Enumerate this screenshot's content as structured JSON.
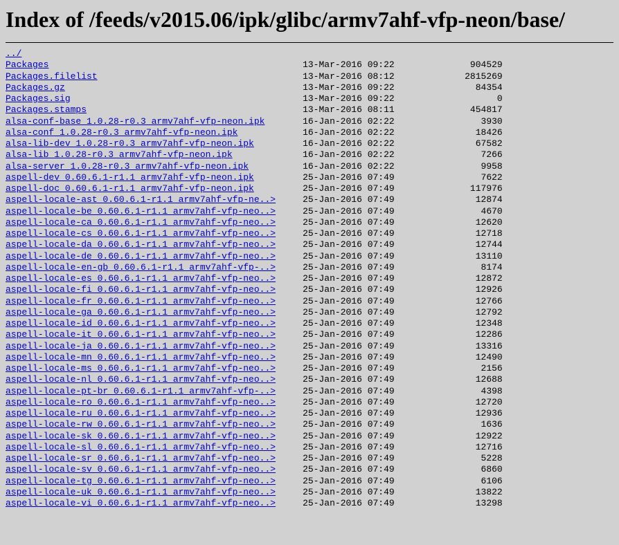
{
  "title": "Index of /feeds/v2015.06/ipk/glibc/armv7ahf-vfp-neon/base/",
  "parent": "../",
  "name_col_width": 55,
  "date_col_width": 17,
  "size_col_width": 19,
  "files": [
    {
      "name": "Packages",
      "date": "13-Mar-2016 09:22",
      "size": "904529"
    },
    {
      "name": "Packages.filelist",
      "date": "13-Mar-2016 08:12",
      "size": "2815269"
    },
    {
      "name": "Packages.gz",
      "date": "13-Mar-2016 09:22",
      "size": "84354"
    },
    {
      "name": "Packages.sig",
      "date": "13-Mar-2016 09:22",
      "size": "0"
    },
    {
      "name": "Packages.stamps",
      "date": "13-Mar-2016 08:11",
      "size": "454817"
    },
    {
      "name": "alsa-conf-base_1.0.28-r0.3_armv7ahf-vfp-neon.ipk",
      "date": "16-Jan-2016 02:22",
      "size": "3930"
    },
    {
      "name": "alsa-conf_1.0.28-r0.3_armv7ahf-vfp-neon.ipk",
      "date": "16-Jan-2016 02:22",
      "size": "18426"
    },
    {
      "name": "alsa-lib-dev_1.0.28-r0.3_armv7ahf-vfp-neon.ipk",
      "date": "16-Jan-2016 02:22",
      "size": "67582"
    },
    {
      "name": "alsa-lib_1.0.28-r0.3_armv7ahf-vfp-neon.ipk",
      "date": "16-Jan-2016 02:22",
      "size": "7266"
    },
    {
      "name": "alsa-server_1.0.28-r0.3_armv7ahf-vfp-neon.ipk",
      "date": "16-Jan-2016 02:22",
      "size": "9958"
    },
    {
      "name": "aspell-dev_0.60.6.1-r1.1_armv7ahf-vfp-neon.ipk",
      "date": "25-Jan-2016 07:49",
      "size": "7622"
    },
    {
      "name": "aspell-doc_0.60.6.1-r1.1_armv7ahf-vfp-neon.ipk",
      "date": "25-Jan-2016 07:49",
      "size": "117976"
    },
    {
      "name": "aspell-locale-ast_0.60.6.1-r1.1_armv7ahf-vfp-ne..>",
      "date": "25-Jan-2016 07:49",
      "size": "12874"
    },
    {
      "name": "aspell-locale-be_0.60.6.1-r1.1_armv7ahf-vfp-neo..>",
      "date": "25-Jan-2016 07:49",
      "size": "4670"
    },
    {
      "name": "aspell-locale-ca_0.60.6.1-r1.1_armv7ahf-vfp-neo..>",
      "date": "25-Jan-2016 07:49",
      "size": "12620"
    },
    {
      "name": "aspell-locale-cs_0.60.6.1-r1.1_armv7ahf-vfp-neo..>",
      "date": "25-Jan-2016 07:49",
      "size": "12718"
    },
    {
      "name": "aspell-locale-da_0.60.6.1-r1.1_armv7ahf-vfp-neo..>",
      "date": "25-Jan-2016 07:49",
      "size": "12744"
    },
    {
      "name": "aspell-locale-de_0.60.6.1-r1.1_armv7ahf-vfp-neo..>",
      "date": "25-Jan-2016 07:49",
      "size": "13110"
    },
    {
      "name": "aspell-locale-en-gb_0.60.6.1-r1.1_armv7ahf-vfp-..>",
      "date": "25-Jan-2016 07:49",
      "size": "8174"
    },
    {
      "name": "aspell-locale-es_0.60.6.1-r1.1_armv7ahf-vfp-neo..>",
      "date": "25-Jan-2016 07:49",
      "size": "12872"
    },
    {
      "name": "aspell-locale-fi_0.60.6.1-r1.1_armv7ahf-vfp-neo..>",
      "date": "25-Jan-2016 07:49",
      "size": "12926"
    },
    {
      "name": "aspell-locale-fr_0.60.6.1-r1.1_armv7ahf-vfp-neo..>",
      "date": "25-Jan-2016 07:49",
      "size": "12766"
    },
    {
      "name": "aspell-locale-ga_0.60.6.1-r1.1_armv7ahf-vfp-neo..>",
      "date": "25-Jan-2016 07:49",
      "size": "12792"
    },
    {
      "name": "aspell-locale-id_0.60.6.1-r1.1_armv7ahf-vfp-neo..>",
      "date": "25-Jan-2016 07:49",
      "size": "12348"
    },
    {
      "name": "aspell-locale-it_0.60.6.1-r1.1_armv7ahf-vfp-neo..>",
      "date": "25-Jan-2016 07:49",
      "size": "12286"
    },
    {
      "name": "aspell-locale-ja_0.60.6.1-r1.1_armv7ahf-vfp-neo..>",
      "date": "25-Jan-2016 07:49",
      "size": "13316"
    },
    {
      "name": "aspell-locale-mn_0.60.6.1-r1.1_armv7ahf-vfp-neo..>",
      "date": "25-Jan-2016 07:49",
      "size": "12490"
    },
    {
      "name": "aspell-locale-ms_0.60.6.1-r1.1_armv7ahf-vfp-neo..>",
      "date": "25-Jan-2016 07:49",
      "size": "2156"
    },
    {
      "name": "aspell-locale-nl_0.60.6.1-r1.1_armv7ahf-vfp-neo..>",
      "date": "25-Jan-2016 07:49",
      "size": "12688"
    },
    {
      "name": "aspell-locale-pt-br_0.60.6.1-r1.1_armv7ahf-vfp-..>",
      "date": "25-Jan-2016 07:49",
      "size": "4398"
    },
    {
      "name": "aspell-locale-ro_0.60.6.1-r1.1_armv7ahf-vfp-neo..>",
      "date": "25-Jan-2016 07:49",
      "size": "12720"
    },
    {
      "name": "aspell-locale-ru_0.60.6.1-r1.1_armv7ahf-vfp-neo..>",
      "date": "25-Jan-2016 07:49",
      "size": "12936"
    },
    {
      "name": "aspell-locale-rw_0.60.6.1-r1.1_armv7ahf-vfp-neo..>",
      "date": "25-Jan-2016 07:49",
      "size": "1636"
    },
    {
      "name": "aspell-locale-sk_0.60.6.1-r1.1_armv7ahf-vfp-neo..>",
      "date": "25-Jan-2016 07:49",
      "size": "12922"
    },
    {
      "name": "aspell-locale-sl_0.60.6.1-r1.1_armv7ahf-vfp-neo..>",
      "date": "25-Jan-2016 07:49",
      "size": "12716"
    },
    {
      "name": "aspell-locale-sr_0.60.6.1-r1.1_armv7ahf-vfp-neo..>",
      "date": "25-Jan-2016 07:49",
      "size": "5228"
    },
    {
      "name": "aspell-locale-sv_0.60.6.1-r1.1_armv7ahf-vfp-neo..>",
      "date": "25-Jan-2016 07:49",
      "size": "6860"
    },
    {
      "name": "aspell-locale-tg_0.60.6.1-r1.1_armv7ahf-vfp-neo..>",
      "date": "25-Jan-2016 07:49",
      "size": "6106"
    },
    {
      "name": "aspell-locale-uk_0.60.6.1-r1.1_armv7ahf-vfp-neo..>",
      "date": "25-Jan-2016 07:49",
      "size": "13822"
    },
    {
      "name": "aspell-locale-vi_0.60.6.1-r1.1_armv7ahf-vfp-neo..>",
      "date": "25-Jan-2016 07:49",
      "size": "13298"
    }
  ]
}
